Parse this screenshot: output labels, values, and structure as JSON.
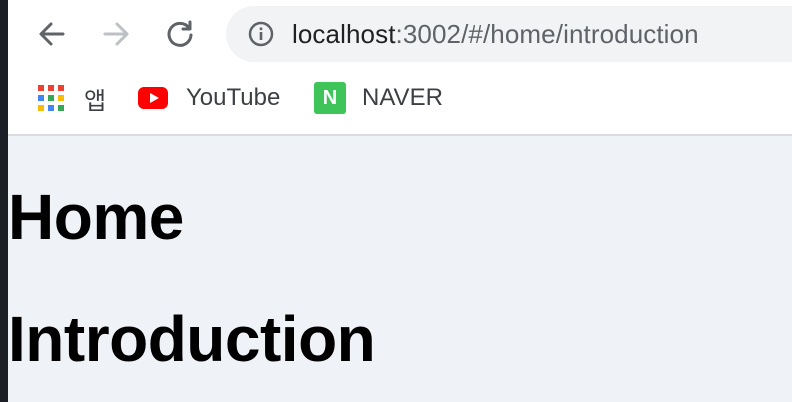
{
  "browser": {
    "url_host": "localhost",
    "url_rest": ":3002/#/home/introduction"
  },
  "bookmarks": [
    {
      "label": "앱",
      "icon": "apps-grid-icon"
    },
    {
      "label": "YouTube",
      "icon": "youtube-icon"
    },
    {
      "label": "NAVER",
      "icon": "naver-icon",
      "icon_text": "N"
    }
  ],
  "page": {
    "heading_1": "Home",
    "heading_2": "Introduction"
  },
  "colors": {
    "content_background": "#eff2f7",
    "youtube_red": "#ff0000",
    "naver_green": "#3fc45a"
  }
}
